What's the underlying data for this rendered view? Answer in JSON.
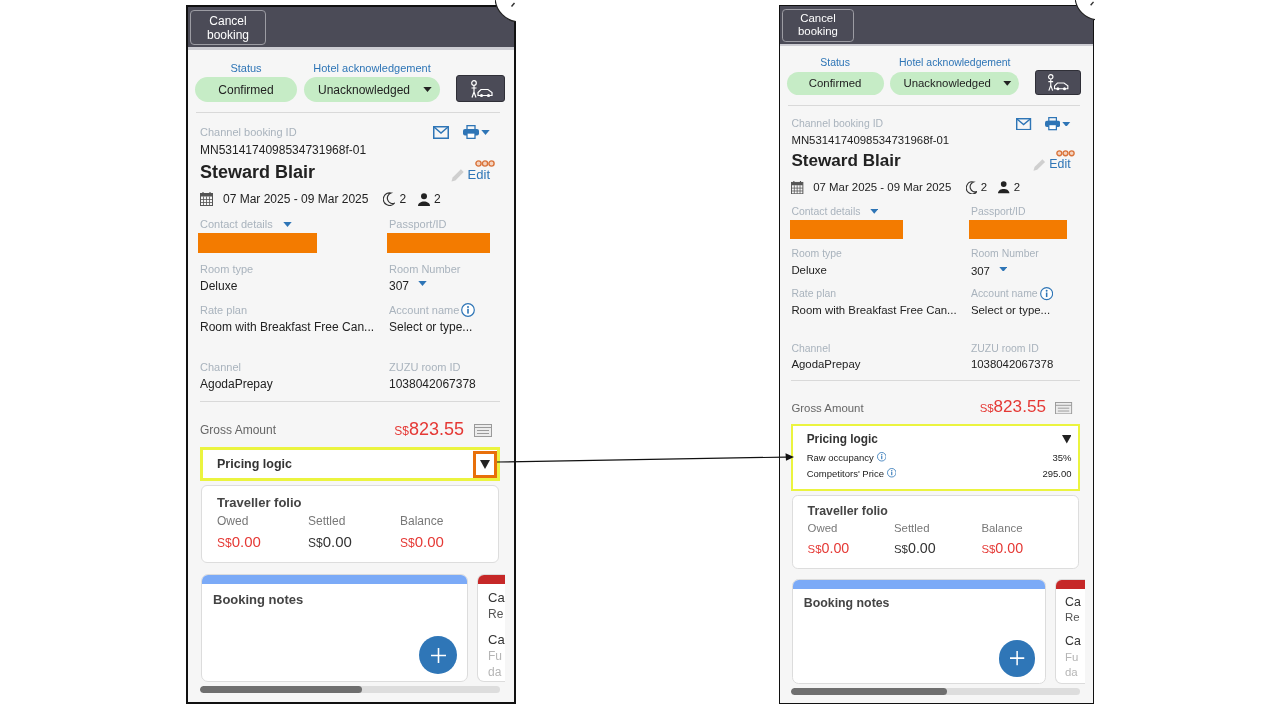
{
  "panels": [
    {
      "cancel_button": "Cancel booking",
      "status": {
        "label": "Status",
        "value": "Confirmed"
      },
      "acknowledgement": {
        "label": "Hotel acknowledgement",
        "value": "Unacknowledged"
      },
      "booking": {
        "id_label": "Channel booking ID",
        "id": "MN5314174098534731968f-01",
        "guest": "Steward Blair",
        "edit": "Edit",
        "dates": "07 Mar 2025 - 09 Mar 2025",
        "nights": "2",
        "guests": "2"
      },
      "fields": [
        {
          "kind": "redacted-select",
          "label": "Contact details"
        },
        {
          "kind": "redacted",
          "label": "Passport/ID"
        },
        {
          "kind": "text",
          "label": "Room type",
          "value": "Deluxe"
        },
        {
          "kind": "select",
          "label": "Room Number",
          "value": "307"
        },
        {
          "kind": "text",
          "label": "Rate plan",
          "value": "Room with Breakfast Free Can..."
        },
        {
          "kind": "lookup",
          "label": "Account name",
          "placeholder": "Select or type..."
        },
        {
          "kind": "text",
          "label": "Channel",
          "value": "AgodaPrepay"
        },
        {
          "kind": "text",
          "label": "ZUZU room ID",
          "value": "1038042067378"
        }
      ],
      "gross": {
        "label": "Gross Amount",
        "currency": "S$",
        "amount": "823.55"
      },
      "pricing": {
        "title": "Pricing logic",
        "expanded": false,
        "highlighted": true,
        "toggle_highlighted": true
      },
      "folio": {
        "title": "Traveller folio",
        "columns": [
          {
            "label": "Owed",
            "currency": "S$",
            "amount": "0.00",
            "color": "#e53935"
          },
          {
            "label": "Settled",
            "currency": "S$",
            "amount": "0.00",
            "color": "#333333"
          },
          {
            "label": "Balance",
            "currency": "S$",
            "amount": "0.00",
            "color": "#e53935"
          }
        ]
      },
      "cards": [
        {
          "kind": "notes",
          "title": "Booking notes",
          "color": "#7baaf7"
        },
        {
          "kind": "peek",
          "color": "#c62828",
          "lines": [
            {
              "kind": "heading",
              "text": "Ca"
            },
            {
              "kind": "text",
              "text": "Re"
            },
            {
              "kind": "heading",
              "text": "Ca"
            },
            {
              "kind": "muted",
              "text": "Fu"
            },
            {
              "kind": "muted",
              "text": "da"
            }
          ]
        }
      ]
    },
    {
      "cancel_button": "Cancel booking",
      "status": {
        "label": "Status",
        "value": "Confirmed"
      },
      "acknowledgement": {
        "label": "Hotel acknowledgement",
        "value": "Unacknowledged"
      },
      "booking": {
        "id_label": "Channel booking ID",
        "id": "MN5314174098534731968f-01",
        "guest": "Steward Blair",
        "edit": "Edit",
        "dates": "07 Mar 2025 - 09 Mar 2025",
        "nights": "2",
        "guests": "2"
      },
      "fields": [
        {
          "kind": "redacted-select",
          "label": "Contact details"
        },
        {
          "kind": "redacted",
          "label": "Passport/ID"
        },
        {
          "kind": "text",
          "label": "Room type",
          "value": "Deluxe"
        },
        {
          "kind": "select",
          "label": "Room Number",
          "value": "307"
        },
        {
          "kind": "text",
          "label": "Rate plan",
          "value": "Room with Breakfast Free Can..."
        },
        {
          "kind": "lookup",
          "label": "Account name",
          "placeholder": "Select or type..."
        },
        {
          "kind": "text",
          "label": "Channel",
          "value": "AgodaPrepay"
        },
        {
          "kind": "text",
          "label": "ZUZU room ID",
          "value": "1038042067378"
        }
      ],
      "gross": {
        "label": "Gross Amount",
        "currency": "S$",
        "amount": "823.55"
      },
      "pricing": {
        "title": "Pricing logic",
        "expanded": true,
        "highlighted": true,
        "toggle_highlighted": false,
        "rows": [
          {
            "label": "Raw occupancy",
            "value": "35%"
          },
          {
            "label": "Competitors' Price",
            "value": "295.00"
          }
        ]
      },
      "folio": {
        "title": "Traveller folio",
        "columns": [
          {
            "label": "Owed",
            "currency": "S$",
            "amount": "0.00",
            "color": "#e53935"
          },
          {
            "label": "Settled",
            "currency": "S$",
            "amount": "0.00",
            "color": "#333333"
          },
          {
            "label": "Balance",
            "currency": "S$",
            "amount": "0.00",
            "color": "#e53935"
          }
        ]
      },
      "cards": [
        {
          "kind": "notes",
          "title": "Booking notes",
          "color": "#7baaf7"
        },
        {
          "kind": "peek",
          "color": "#c62828",
          "lines": [
            {
              "kind": "heading",
              "text": "Ca"
            },
            {
              "kind": "text",
              "text": "Re"
            },
            {
              "kind": "heading",
              "text": "Ca"
            },
            {
              "kind": "muted",
              "text": "Fu"
            },
            {
              "kind": "muted",
              "text": "da"
            }
          ]
        }
      ]
    }
  ]
}
